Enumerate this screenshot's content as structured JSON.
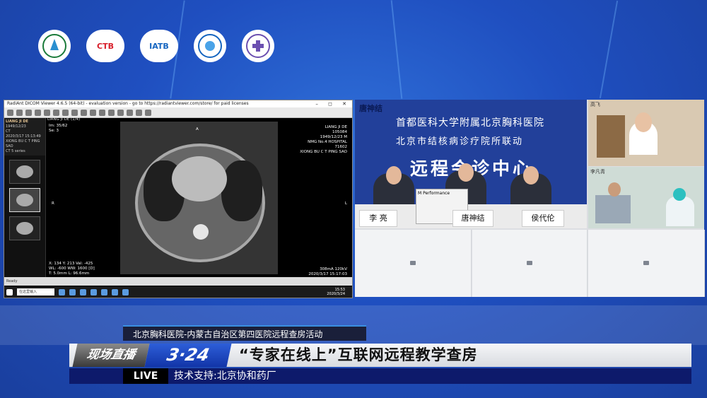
{
  "event": {
    "subtitle": "北京胸科医院-内蒙古自治区第四医院远程查房活动",
    "badge_live": "现场直播",
    "date": "3·24",
    "title": "“专家在线上”互联网远程教学查房",
    "live_label": "LIVE",
    "sponsor": "技术支持:北京协和药厂"
  },
  "logos": [
    {
      "name": "hospital-logo",
      "text": ""
    },
    {
      "name": "ctb-logo",
      "text": "CTB"
    },
    {
      "name": "iatb-logo",
      "text": "IATB"
    },
    {
      "name": "association-logo",
      "text": ""
    },
    {
      "name": "hospital-4th-logo",
      "text": ""
    }
  ],
  "viewer": {
    "title": "RadiAnt DICOM Viewer 4.6.5 (64-bit) - evaluation version - go to https://radiantviewer.com/store/ for paid licenses",
    "patient_name": "LIANG JI DE",
    "patient_birth": "1949/12/23",
    "patient_modality": "CT",
    "study_date": "2020/3/17 15:13:49",
    "hospital": "XIONG BU C T PING SAO",
    "series_name": "CT 5 series",
    "tab_label": "LIANG JI DE (1/4)",
    "overlay_tl_1": "Im: 35/62",
    "overlay_tl_2": "Se: 3",
    "overlay_tr_1": "LIANG JI DE",
    "overlay_tr_2": "105084",
    "overlay_tr_3": "1949/12/23 M",
    "overlay_tr_4": "NMG No.4 HOSPITAL",
    "overlay_tr_5": "71602",
    "overlay_tr_6": "XIONG BU C T PING SAO",
    "overlay_bl_1": "X: 134 Y: 213 Val: -425",
    "overlay_bl_2": "WL: -600 WW: 1600 [D]",
    "overlay_bl_3": "T: 5.0mm L: 96.6mm",
    "overlay_br_1": "308mA 120kV",
    "overlay_br_2": "2020/3/17 15:17:03",
    "orient_top": "A",
    "orient_left": "R",
    "orient_right": "L",
    "status": "Ready",
    "search_text": "在这里输入",
    "time": "15:53",
    "date": "2020/3/24"
  },
  "conference": {
    "main_label": "唐神结",
    "banner_line1": "首都医科大学附属北京胸科医院",
    "banner_line2": "北京市结核病诊疗院所联动",
    "banner_line3": "远程会诊中心",
    "name_left": "李 亮",
    "name_mid": "唐神结",
    "name_right": "侯代伦",
    "laptop_brand": "M Performance",
    "doctor_label": "高飞",
    "ward_label": "李凡青"
  }
}
